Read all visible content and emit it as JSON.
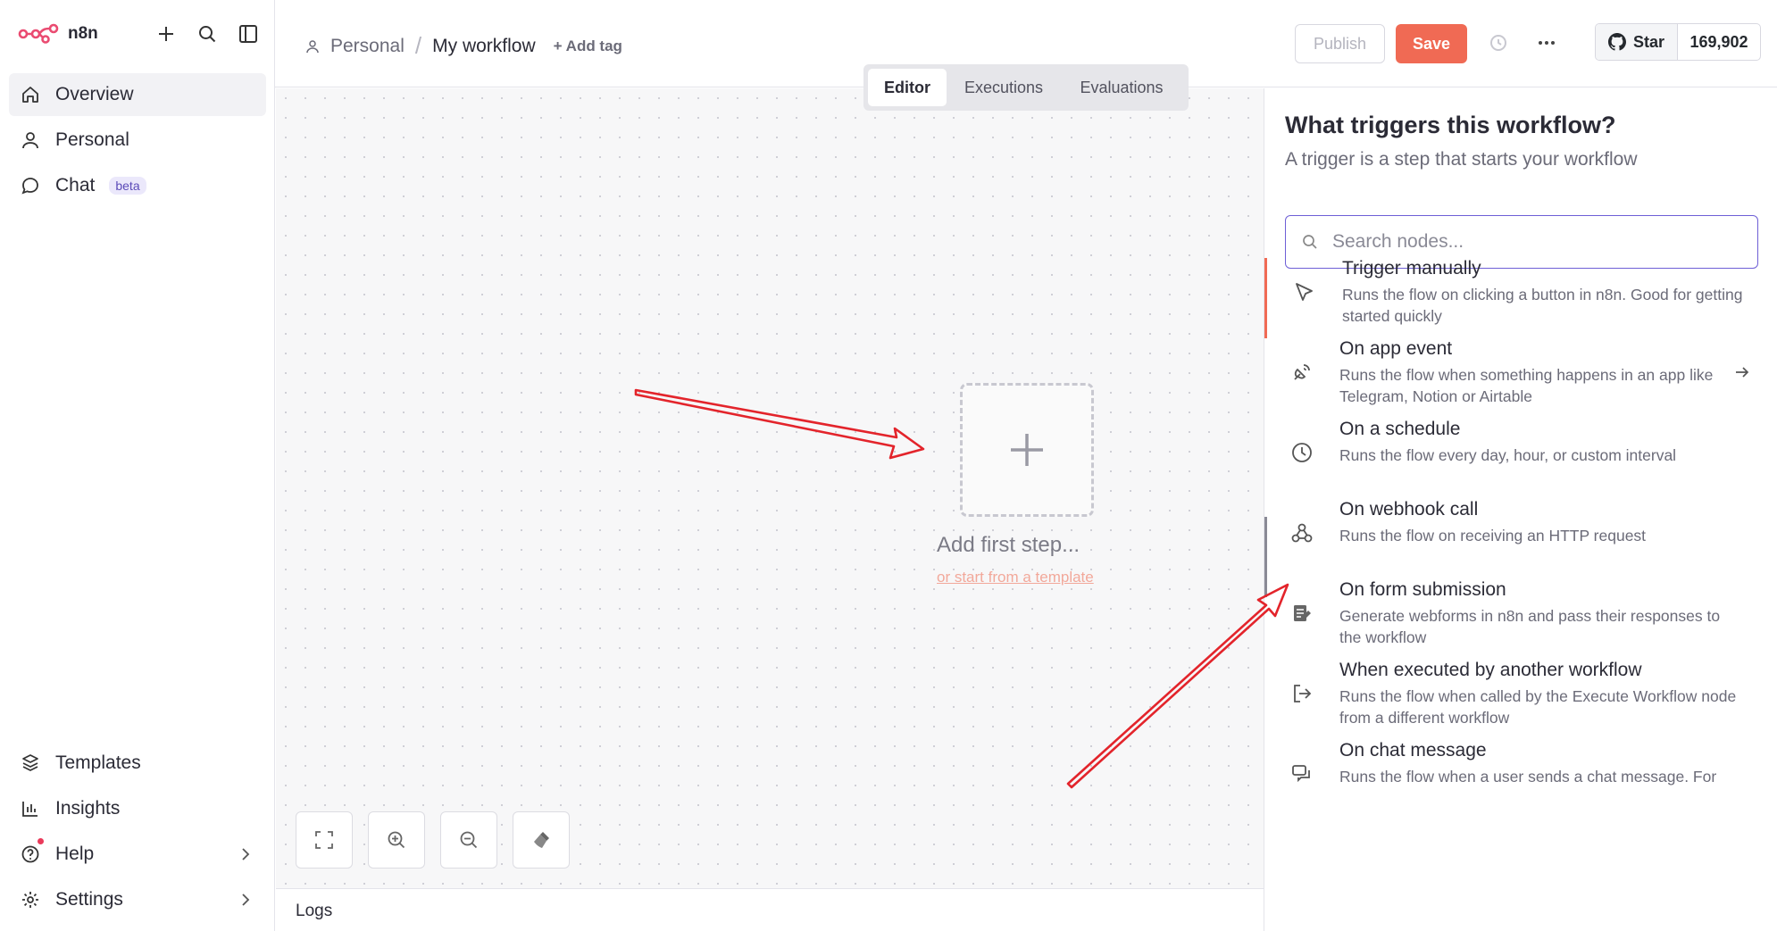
{
  "brand": {
    "name": "n8n",
    "accent": "#ea4b71"
  },
  "sidebar": {
    "top_actions": [
      "plus-icon",
      "search-icon",
      "panel-icon"
    ],
    "items": [
      {
        "label": "Overview",
        "icon": "home-icon",
        "active": true
      },
      {
        "label": "Personal",
        "icon": "user-icon"
      },
      {
        "label": "Chat",
        "icon": "chat-icon",
        "badge": "beta"
      }
    ],
    "bottom_items": [
      {
        "label": "Templates",
        "icon": "templates-icon"
      },
      {
        "label": "Insights",
        "icon": "insights-icon"
      },
      {
        "label": "Help",
        "icon": "help-icon"
      },
      {
        "label": "Settings",
        "icon": "settings-icon"
      }
    ]
  },
  "header": {
    "breadcrumb_project": "Personal",
    "breadcrumb_sep": "/",
    "workflow_name": "My workflow",
    "add_tag": "+ Add tag",
    "publish_label": "Publish",
    "save_label": "Save",
    "github_star": "Star",
    "github_count": "169,902"
  },
  "tabs": [
    {
      "label": "Editor",
      "active": true
    },
    {
      "label": "Executions"
    },
    {
      "label": "Evaluations"
    }
  ],
  "canvas": {
    "add_first_step": "Add first step...",
    "template_link": "or start from a template",
    "logs_label": "Logs"
  },
  "panel": {
    "title": "What triggers this workflow?",
    "subtitle": "A trigger is a step that starts your workflow",
    "search_placeholder": "Search nodes...",
    "triggers": [
      {
        "name": "Trigger manually",
        "desc": "Runs the flow on clicking a button in n8n. Good for getting started quickly",
        "icon": "cursor-icon"
      },
      {
        "name": "On app event",
        "desc": "Runs the flow when something happens in an app like Telegram, Notion or Airtable",
        "icon": "satellite-icon"
      },
      {
        "name": "On a schedule",
        "desc": "Runs the flow every day, hour, or custom interval",
        "icon": "clock-icon"
      },
      {
        "name": "On webhook call",
        "desc": "Runs the flow on receiving an HTTP request",
        "icon": "webhook-icon"
      },
      {
        "name": "On form submission",
        "desc": "Generate webforms in n8n and pass their responses to the workflow",
        "icon": "form-icon"
      },
      {
        "name": "When executed by another workflow",
        "desc": "Runs the flow when called by the Execute Workflow node from a different workflow",
        "icon": "sign-out-icon"
      },
      {
        "name": "On chat message",
        "desc": "Runs the flow when a user sends a chat message. For",
        "icon": "chat-message-icon"
      }
    ]
  }
}
